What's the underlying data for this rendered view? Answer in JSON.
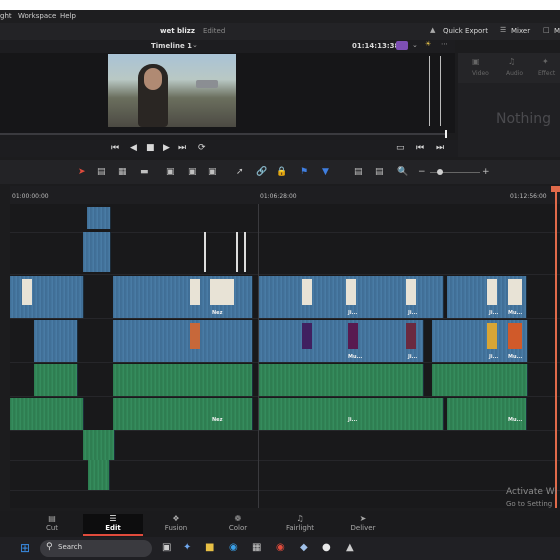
{
  "menubar": {
    "items": [
      "ght",
      "Workspace",
      "Help"
    ]
  },
  "titlebar": {
    "project": "wet blizz",
    "status": "Edited",
    "quick_export": "Quick Export",
    "mixer": "Mixer",
    "extra": "M"
  },
  "viewerbar": {
    "timeline_name": "Timeline 1",
    "timecode": "01:14:13:38"
  },
  "rightpanel": {
    "tabs": [
      "Video",
      "Audio",
      "Effect"
    ],
    "placeholder": "Nothing"
  },
  "ruler": {
    "ticks": [
      "01:00:00:00",
      "01:06:28:00",
      "01:12:56:00"
    ]
  },
  "clips": {
    "labels": [
      "Nez",
      "Ji...",
      "Ji...",
      "Ji...",
      "Mu...",
      "Mu...",
      "Ji...",
      "Ji...",
      "Mu...",
      "Nez",
      "Ji...",
      "Mu..."
    ]
  },
  "pages": [
    {
      "label": "Cut",
      "icon": "cut-icon"
    },
    {
      "label": "Edit",
      "icon": "edit-icon"
    },
    {
      "label": "Fusion",
      "icon": "fusion-icon"
    },
    {
      "label": "Color",
      "icon": "color-icon"
    },
    {
      "label": "Fairlight",
      "icon": "fairlight-icon"
    },
    {
      "label": "Deliver",
      "icon": "deliver-icon"
    }
  ],
  "taskbar": {
    "search": "Search"
  },
  "watermark": {
    "line1": "Activate Wi",
    "line2": "Go to Setting"
  }
}
